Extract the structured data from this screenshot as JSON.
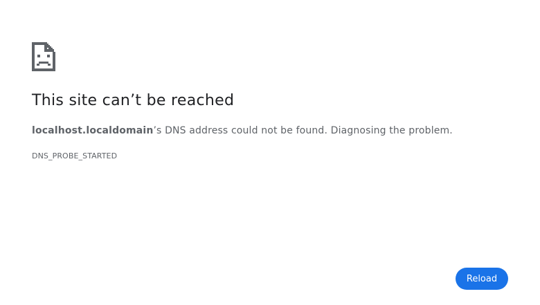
{
  "icon": {
    "name": "sad-page-icon",
    "color": "#5f6368"
  },
  "error": {
    "title": "This site can’t be reached",
    "host": "localhost.localdomain",
    "message_suffix": "’s DNS address could not be found. Diagnosing the problem.",
    "code": "DNS_PROBE_STARTED"
  },
  "actions": {
    "reload_label": "Reload",
    "accent": "#1a73e8"
  }
}
